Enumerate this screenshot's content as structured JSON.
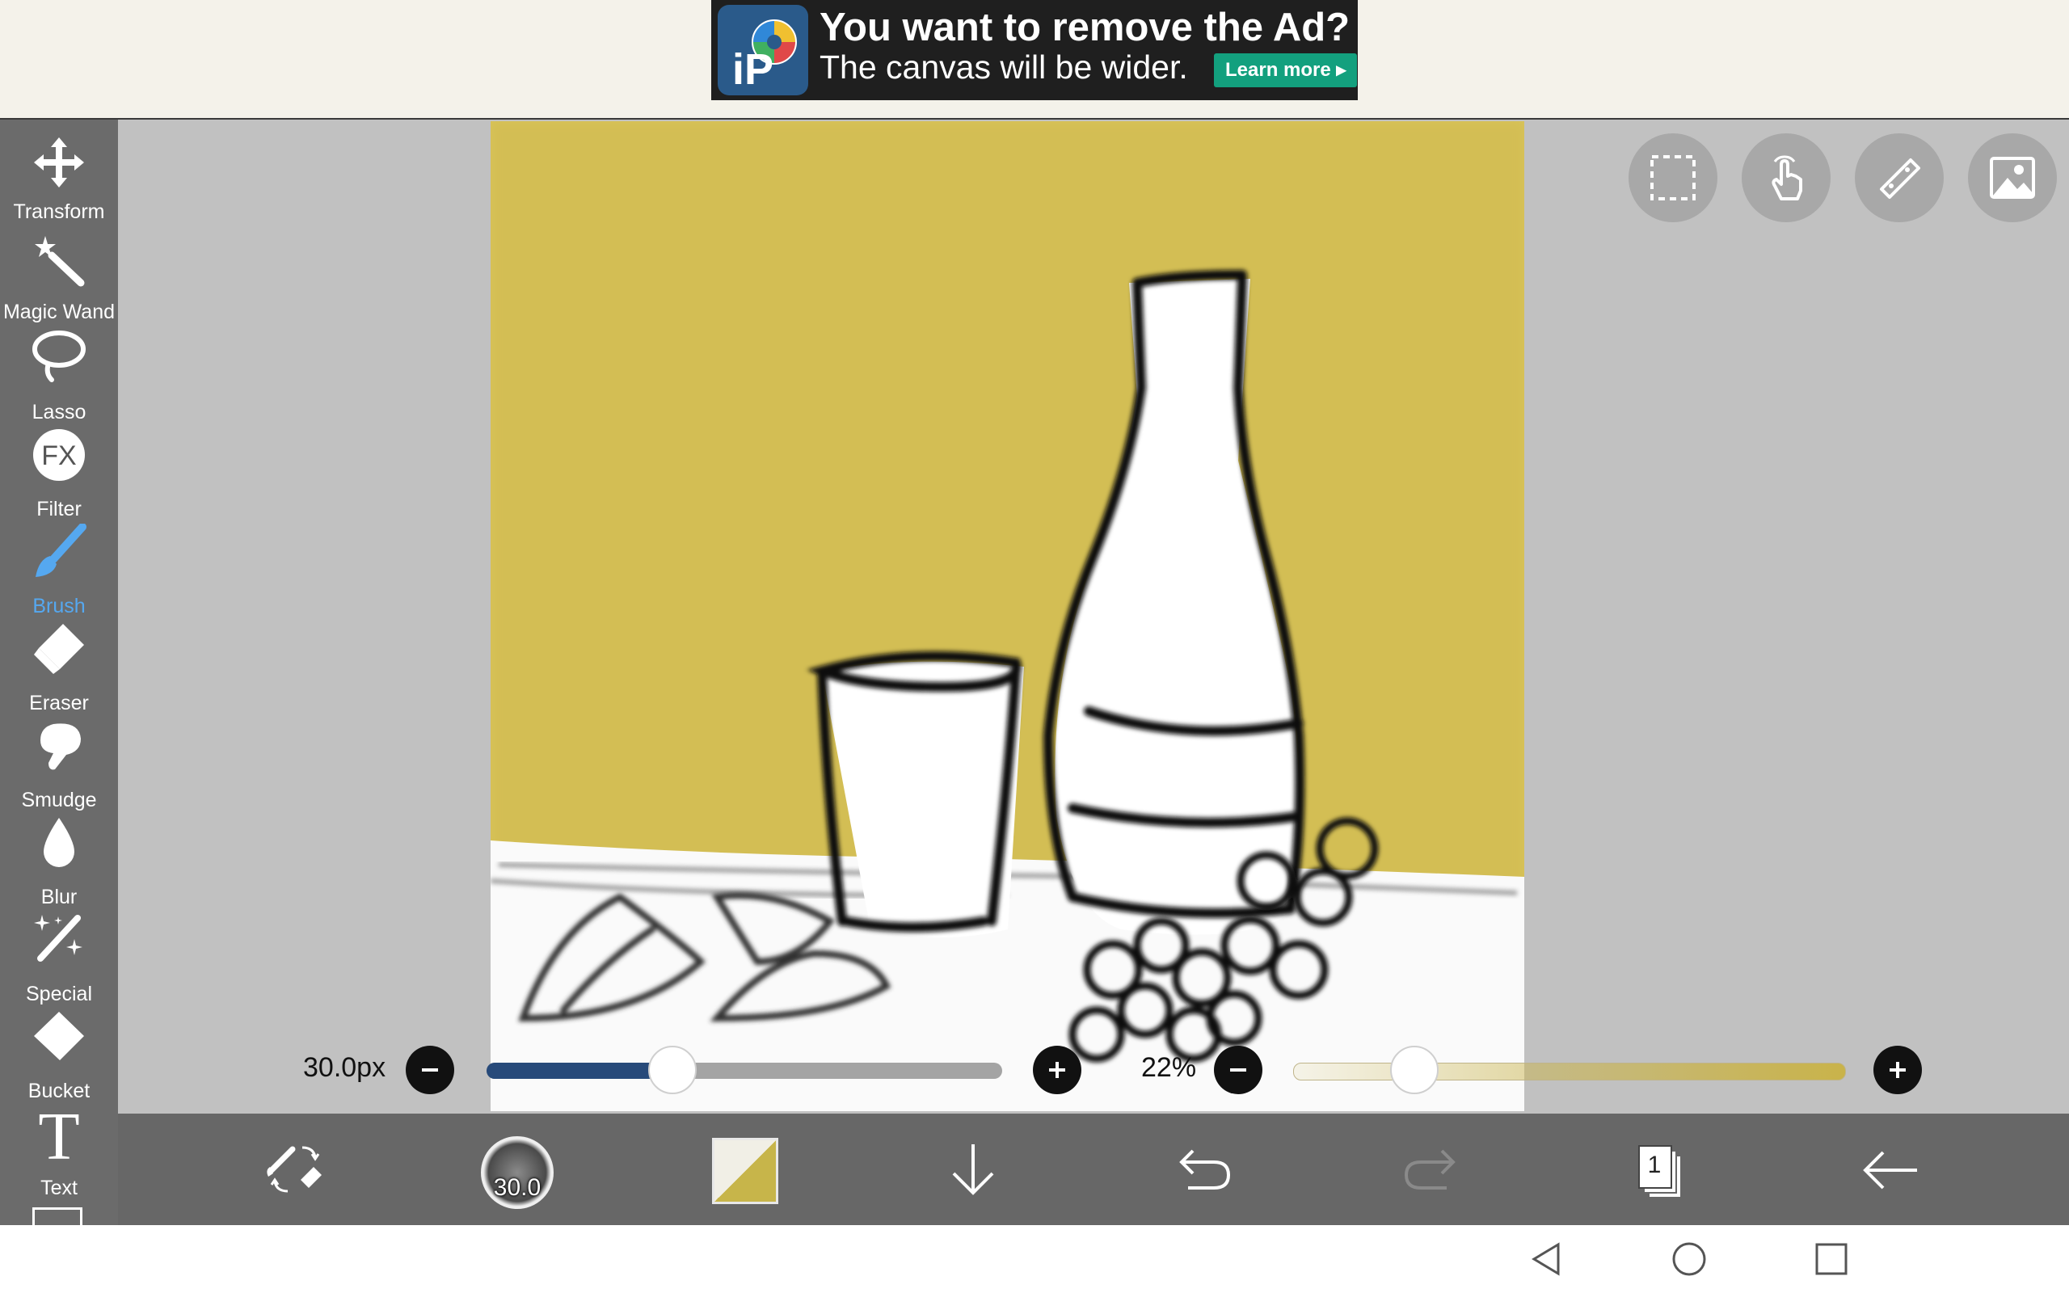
{
  "ad": {
    "title": "You want to remove the Ad?",
    "subtitle": "The canvas will be wider.",
    "button": "Learn more ▸",
    "logo_text": "iP"
  },
  "tools": [
    {
      "name": "transform",
      "label": "Transform",
      "icon": "move-arrows-icon"
    },
    {
      "name": "magic-wand",
      "label": "Magic Wand",
      "icon": "magic-wand-icon"
    },
    {
      "name": "lasso",
      "label": "Lasso",
      "icon": "lasso-icon"
    },
    {
      "name": "filter",
      "label": "Filter",
      "icon": "fx-icon",
      "icon_text": "FX"
    },
    {
      "name": "brush",
      "label": "Brush",
      "icon": "brush-icon",
      "active": true
    },
    {
      "name": "eraser",
      "label": "Eraser",
      "icon": "eraser-icon"
    },
    {
      "name": "smudge",
      "label": "Smudge",
      "icon": "smudge-icon"
    },
    {
      "name": "blur",
      "label": "Blur",
      "icon": "droplet-icon"
    },
    {
      "name": "special",
      "label": "Special",
      "icon": "special-wand-icon"
    },
    {
      "name": "bucket",
      "label": "Bucket",
      "icon": "bucket-icon"
    },
    {
      "name": "text",
      "label": "Text",
      "icon": "text-t-icon",
      "icon_text": "T"
    }
  ],
  "floating_buttons": [
    "selection-icon",
    "hand-touch-icon",
    "ruler-icon",
    "image-icon"
  ],
  "brush_size": {
    "label": "30.0px",
    "value": 30.0,
    "slider_fraction": 0.36
  },
  "opacity": {
    "label": "22%",
    "value": 22
  },
  "bottom_bar": {
    "brush_size_text": "30.0",
    "layer_count": "1",
    "icons": [
      "swap-tool-icon",
      "brush-preview",
      "color-swatch",
      "download-arrow-icon",
      "undo-icon",
      "redo-icon",
      "layers-icon",
      "back-arrow-icon"
    ]
  },
  "colors": {
    "accent_blue": "#55a8f0",
    "background_yellow": "#d9c45a",
    "slider_fill": "#274a7a"
  },
  "navbar": [
    "nav-back-icon",
    "nav-home-icon",
    "nav-recents-icon"
  ]
}
